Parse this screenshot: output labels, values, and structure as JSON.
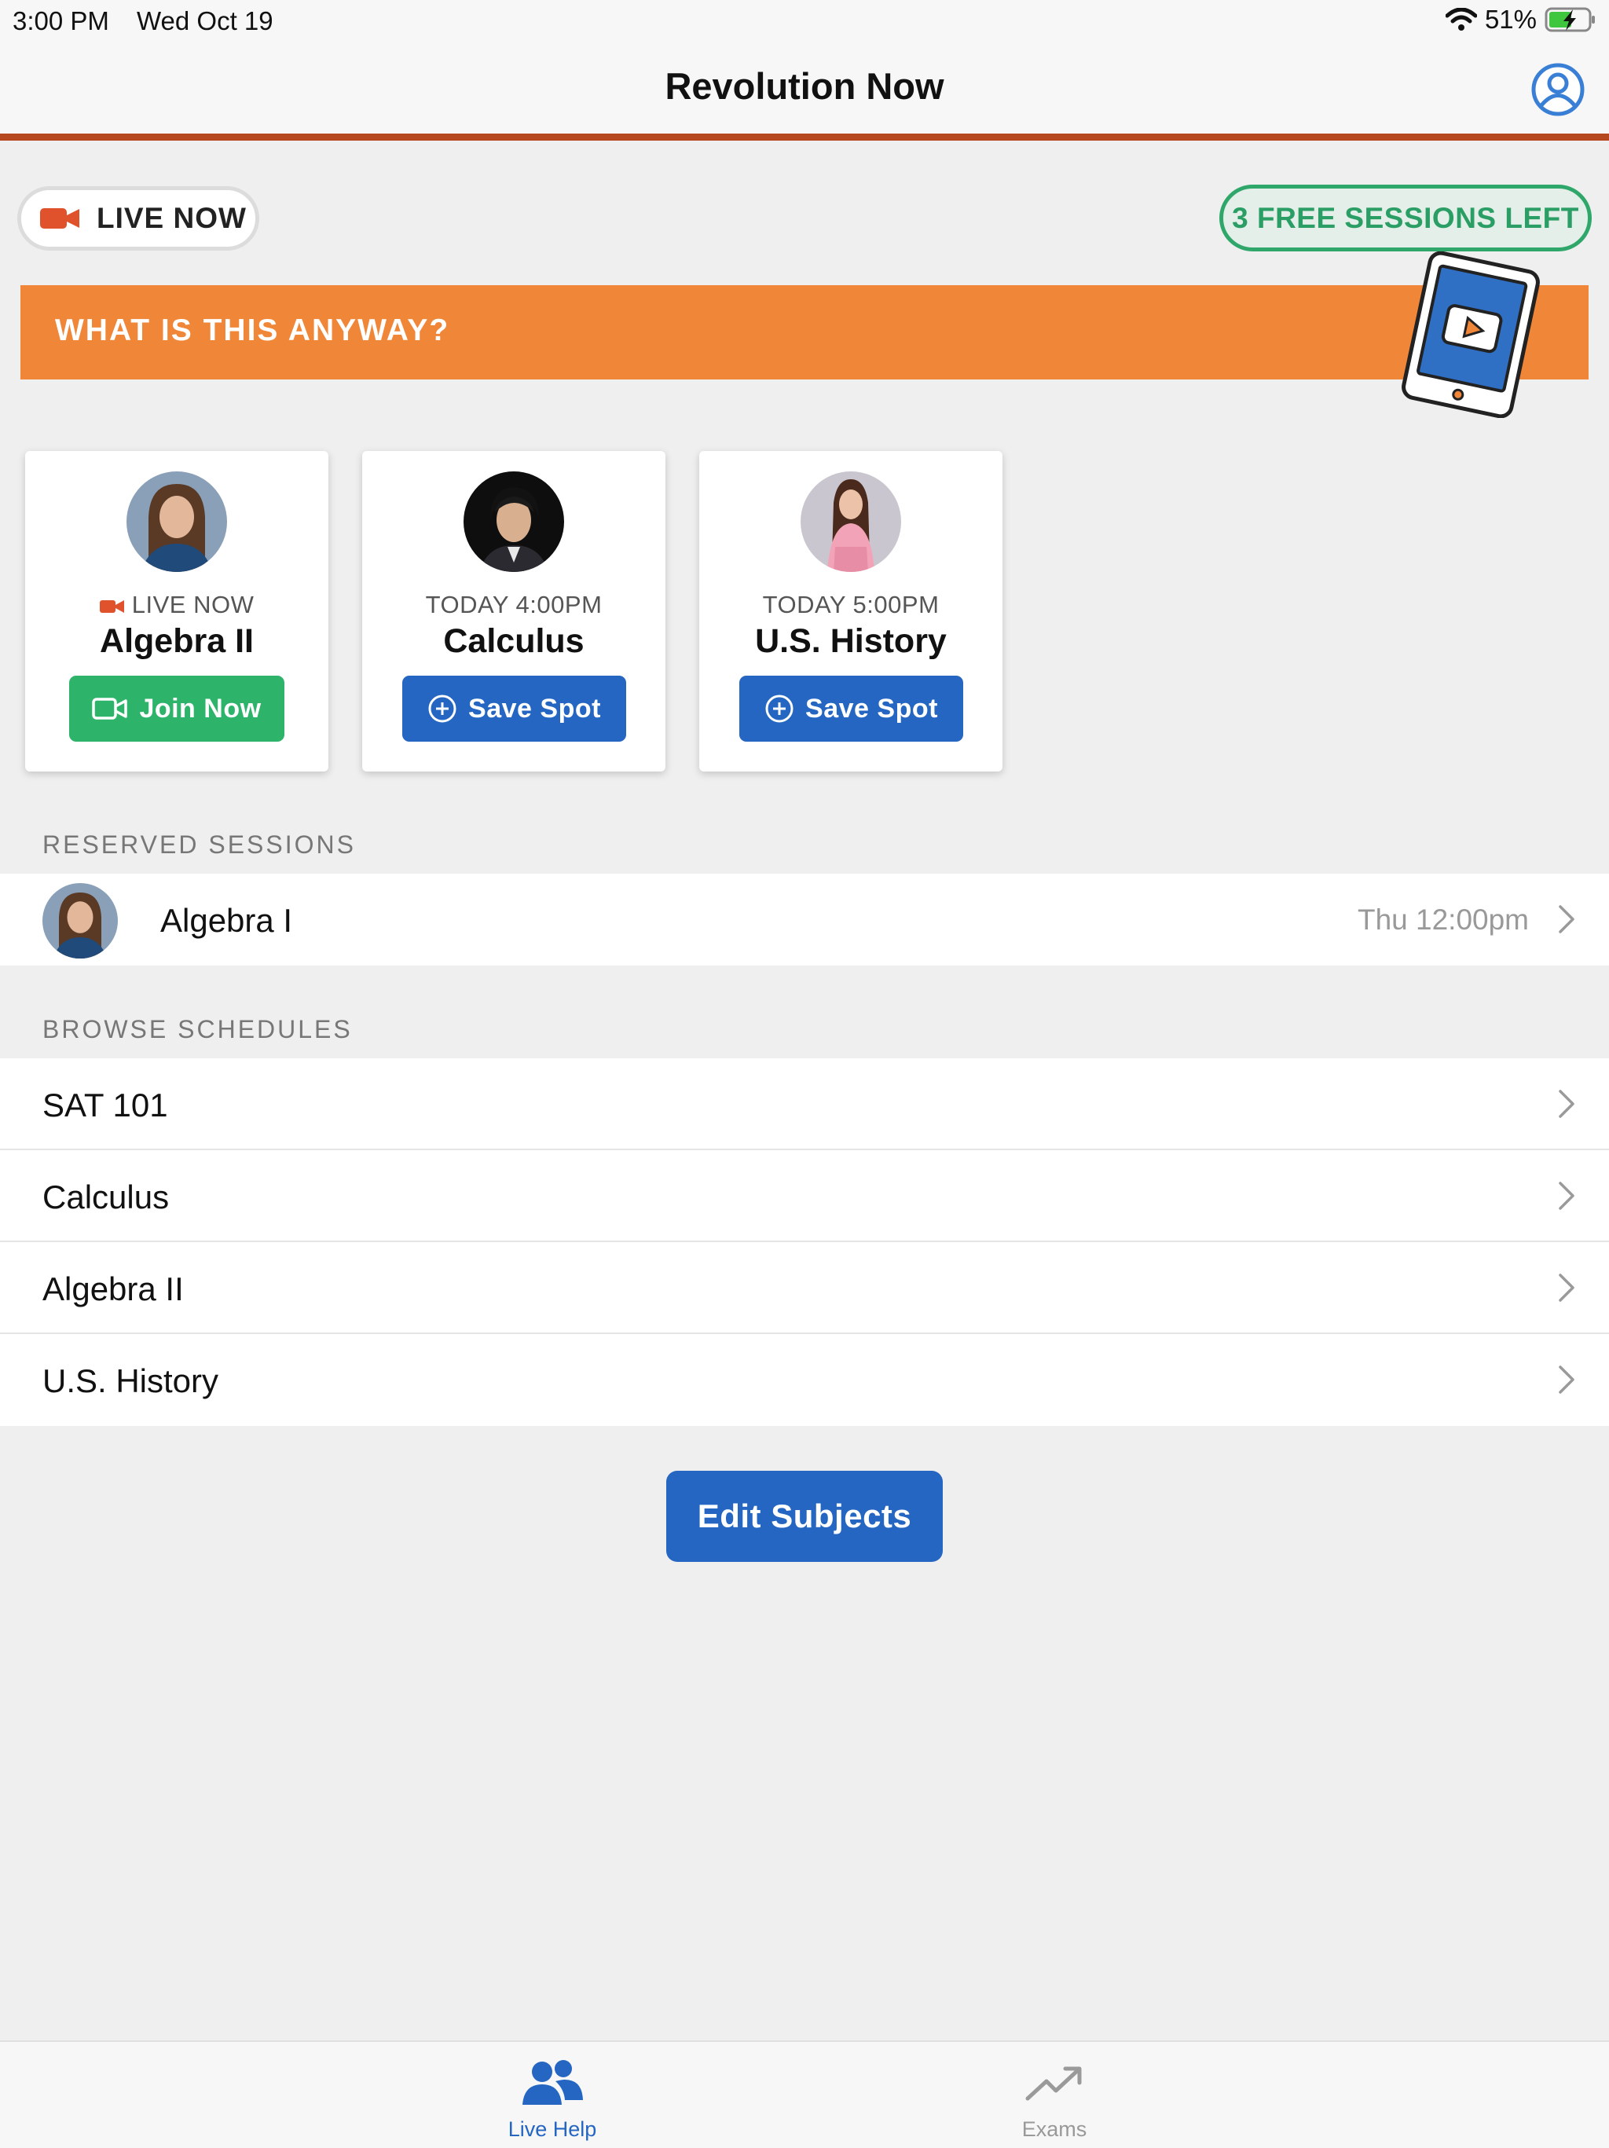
{
  "status_bar": {
    "time": "3:00 PM",
    "date": "Wed Oct 19",
    "battery": "51%"
  },
  "header": {
    "title": "Revolution Now"
  },
  "live_pill": {
    "label": "LIVE NOW"
  },
  "free_sessions": {
    "label": "3 FREE SESSIONS LEFT"
  },
  "banner": {
    "label": "WHAT IS THIS ANYWAY?"
  },
  "cards": [
    {
      "time": "LIVE NOW",
      "subject": "Algebra II",
      "button": "Join Now"
    },
    {
      "time": "TODAY 4:00PM",
      "subject": "Calculus",
      "button": "Save Spot"
    },
    {
      "time": "TODAY 5:00PM",
      "subject": "U.S. History",
      "button": "Save Spot"
    }
  ],
  "reserved": {
    "header": "RESERVED SESSIONS",
    "items": [
      {
        "subject": "Algebra I",
        "time": "Thu 12:00pm"
      }
    ]
  },
  "browse": {
    "header": "BROWSE SCHEDULES",
    "items": [
      {
        "label": "SAT 101"
      },
      {
        "label": "Calculus"
      },
      {
        "label": "Algebra II"
      },
      {
        "label": "U.S. History"
      }
    ]
  },
  "edit_subjects": {
    "label": "Edit Subjects"
  },
  "tabs": [
    {
      "label": "Live Help",
      "active": true
    },
    {
      "label": "Exams",
      "active": false
    }
  ],
  "colors": {
    "accent_orange": "#f08638",
    "header_underline": "#b5481f",
    "primary_blue": "#2466c2",
    "success_green": "#2db36a",
    "live_red": "#e0522c"
  }
}
